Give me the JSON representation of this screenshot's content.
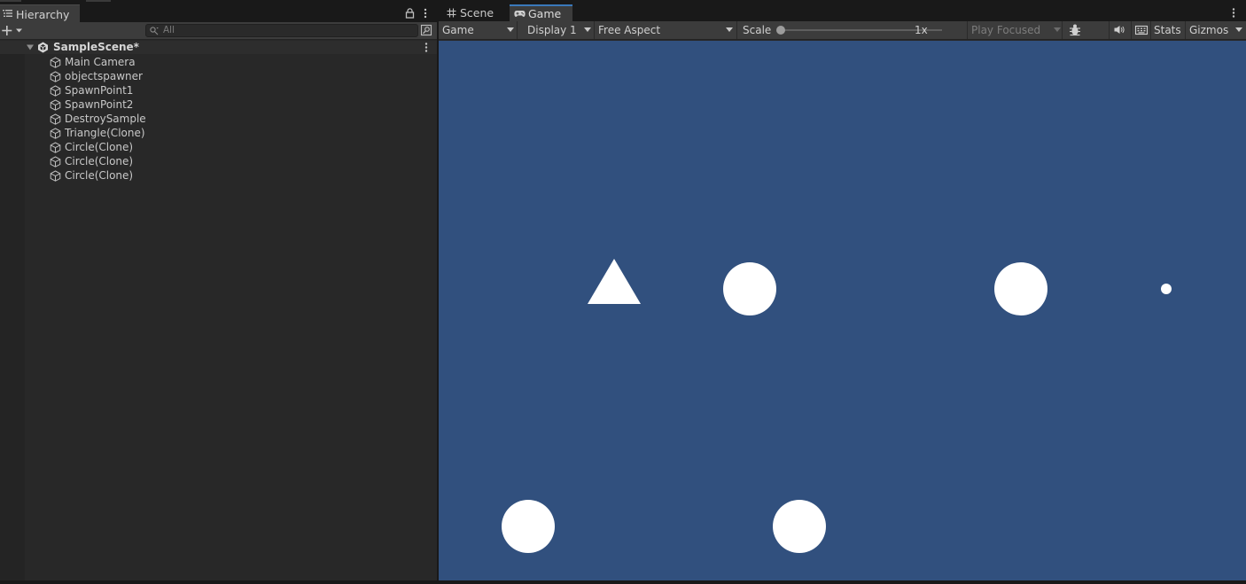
{
  "colors": {
    "panel_bg": "#282828",
    "tab_active_bg": "#3c3c3c",
    "accent": "#3a79bb",
    "game_background": "#31507e",
    "sprite": "#ffffff"
  },
  "hierarchy": {
    "tab_label": "Hierarchy",
    "tab_icon": "list-icon",
    "search_placeholder": "All",
    "scene": {
      "name": "SampleScene*",
      "icon": "unity-logo-icon"
    },
    "items": [
      {
        "label": "Main Camera",
        "icon": "cube-icon"
      },
      {
        "label": "objectspawner",
        "icon": "cube-icon"
      },
      {
        "label": "SpawnPoint1",
        "icon": "cube-icon"
      },
      {
        "label": "SpawnPoint2",
        "icon": "cube-icon"
      },
      {
        "label": "DestroySample",
        "icon": "cube-icon"
      },
      {
        "label": "Triangle(Clone)",
        "icon": "cube-icon"
      },
      {
        "label": "Circle(Clone)",
        "icon": "cube-icon"
      },
      {
        "label": "Circle(Clone)",
        "icon": "cube-icon"
      },
      {
        "label": "Circle(Clone)",
        "icon": "cube-icon"
      }
    ]
  },
  "game": {
    "tabs": [
      {
        "label": "Scene",
        "icon": "grid-icon",
        "active": false
      },
      {
        "label": "Game",
        "icon": "gamepad-icon",
        "active": true
      }
    ],
    "toolbar": {
      "view_mode": "Game",
      "display": "Display 1",
      "aspect": "Free Aspect",
      "scale_label": "Scale",
      "scale_value": "1x",
      "play_mode": "Play Focused",
      "stats_label": "Stats",
      "gizmos_label": "Gizmos",
      "icons": [
        "bug-icon",
        "speaker-icon",
        "keyboard-icon"
      ]
    }
  }
}
